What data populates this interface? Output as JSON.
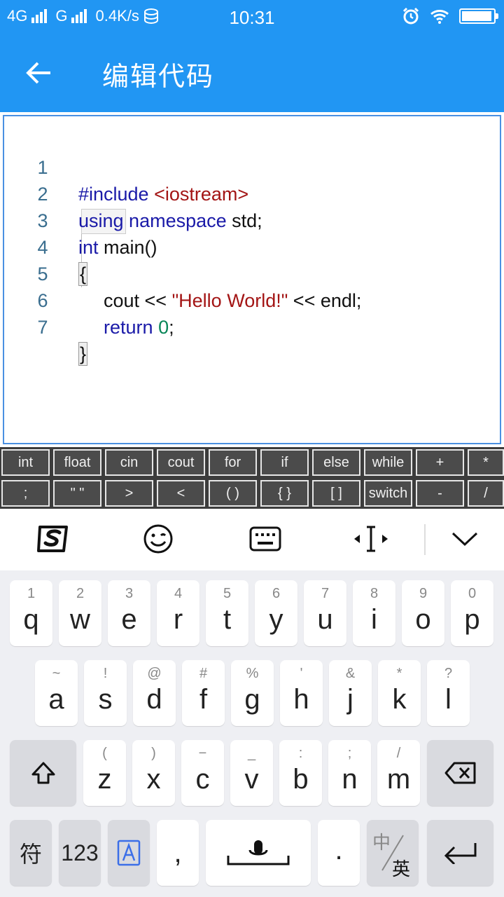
{
  "status_bar": {
    "network1": "4G",
    "network2": "G",
    "speed": "0.4K/s",
    "time": "10:31",
    "battery_level": 0.95
  },
  "app_bar": {
    "title": "编辑代码",
    "back_icon": "arrow-left-icon"
  },
  "editor": {
    "lines": [
      {
        "no": "1"
      },
      {
        "no": "2"
      },
      {
        "no": "3"
      },
      {
        "no": "4"
      },
      {
        "no": "5"
      },
      {
        "no": "6"
      },
      {
        "no": "7"
      }
    ],
    "tokens": {
      "l1_a": "#include ",
      "l1_b": "<iostream>",
      "l2_a": "using namespace",
      "l2_b": " std;",
      "l3_a": "int",
      "l3_b": " main()",
      "l4_a": "{",
      "l5_a": "cout << ",
      "l5_b": "\"Hello World!\"",
      "l5_c": " << endl;",
      "l6_a": "return",
      "l6_b": " ",
      "l6_c": "0",
      "l6_d": ";",
      "l7_a": "}"
    }
  },
  "shortcuts": {
    "row1": [
      "int",
      "float",
      "cin",
      "cout",
      "for",
      "if",
      "else",
      "while",
      "+",
      "*"
    ],
    "row2": [
      ";",
      "\" \"",
      ">",
      "<",
      "( )",
      "{ }",
      "[ ]",
      "switch",
      "-",
      "/"
    ]
  },
  "ime_toolbar": {
    "icons": [
      "sogou-logo-icon",
      "emoji-icon",
      "keyboard-icon",
      "cursor-move-icon",
      "collapse-keyboard-icon"
    ]
  },
  "keyboard": {
    "row1": [
      {
        "hint": "1",
        "ch": "q"
      },
      {
        "hint": "2",
        "ch": "w"
      },
      {
        "hint": "3",
        "ch": "e"
      },
      {
        "hint": "4",
        "ch": "r"
      },
      {
        "hint": "5",
        "ch": "t"
      },
      {
        "hint": "6",
        "ch": "y"
      },
      {
        "hint": "7",
        "ch": "u"
      },
      {
        "hint": "8",
        "ch": "i"
      },
      {
        "hint": "9",
        "ch": "o"
      },
      {
        "hint": "0",
        "ch": "p"
      }
    ],
    "row2": [
      {
        "hint": "~",
        "ch": "a"
      },
      {
        "hint": "!",
        "ch": "s"
      },
      {
        "hint": "@",
        "ch": "d"
      },
      {
        "hint": "#",
        "ch": "f"
      },
      {
        "hint": "%",
        "ch": "g"
      },
      {
        "hint": "'",
        "ch": "h"
      },
      {
        "hint": "&",
        "ch": "j"
      },
      {
        "hint": "*",
        "ch": "k"
      },
      {
        "hint": "?",
        "ch": "l"
      }
    ],
    "row3": [
      {
        "hint": "(",
        "ch": "z"
      },
      {
        "hint": ")",
        "ch": "x"
      },
      {
        "hint": "−",
        "ch": "c"
      },
      {
        "hint": "_",
        "ch": "v"
      },
      {
        "hint": ":",
        "ch": "b"
      },
      {
        "hint": ";",
        "ch": "n"
      },
      {
        "hint": "/",
        "ch": "m"
      }
    ],
    "bottom": {
      "symbols": "符",
      "numbers": "123",
      "comma": ",",
      "period": ".",
      "lang_top": "中",
      "lang_bottom": "英"
    }
  }
}
